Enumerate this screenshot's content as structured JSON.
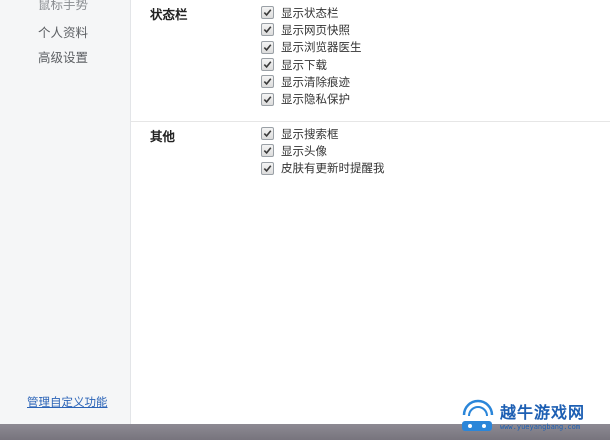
{
  "sidebar": {
    "partial_item": "鼠标手势",
    "items": [
      {
        "label": "个人资料"
      },
      {
        "label": "高级设置"
      }
    ],
    "manage_link": "管理自定义功能"
  },
  "sections": {
    "statusbar": {
      "title": "状态栏",
      "options": [
        {
          "label": "显示状态栏",
          "checked": true
        },
        {
          "label": "显示网页快照",
          "checked": true
        },
        {
          "label": "显示浏览器医生",
          "checked": true
        },
        {
          "label": "显示下载",
          "checked": true
        },
        {
          "label": "显示清除痕迹",
          "checked": true
        },
        {
          "label": "显示隐私保护",
          "checked": true
        }
      ]
    },
    "other": {
      "title": "其他",
      "options": [
        {
          "label": "显示搜索框",
          "checked": true
        },
        {
          "label": "显示头像",
          "checked": true
        },
        {
          "label": "皮肤有更新时提醒我",
          "checked": true
        }
      ]
    }
  },
  "watermark": {
    "title": "越牛游戏网",
    "url": "www.yueyangbang.com"
  },
  "colors": {
    "link": "#2a63b7",
    "sidebar_bg": "#f5f6f7",
    "bottom_bar": "#807d86",
    "watermark": "#1d5fb3"
  }
}
